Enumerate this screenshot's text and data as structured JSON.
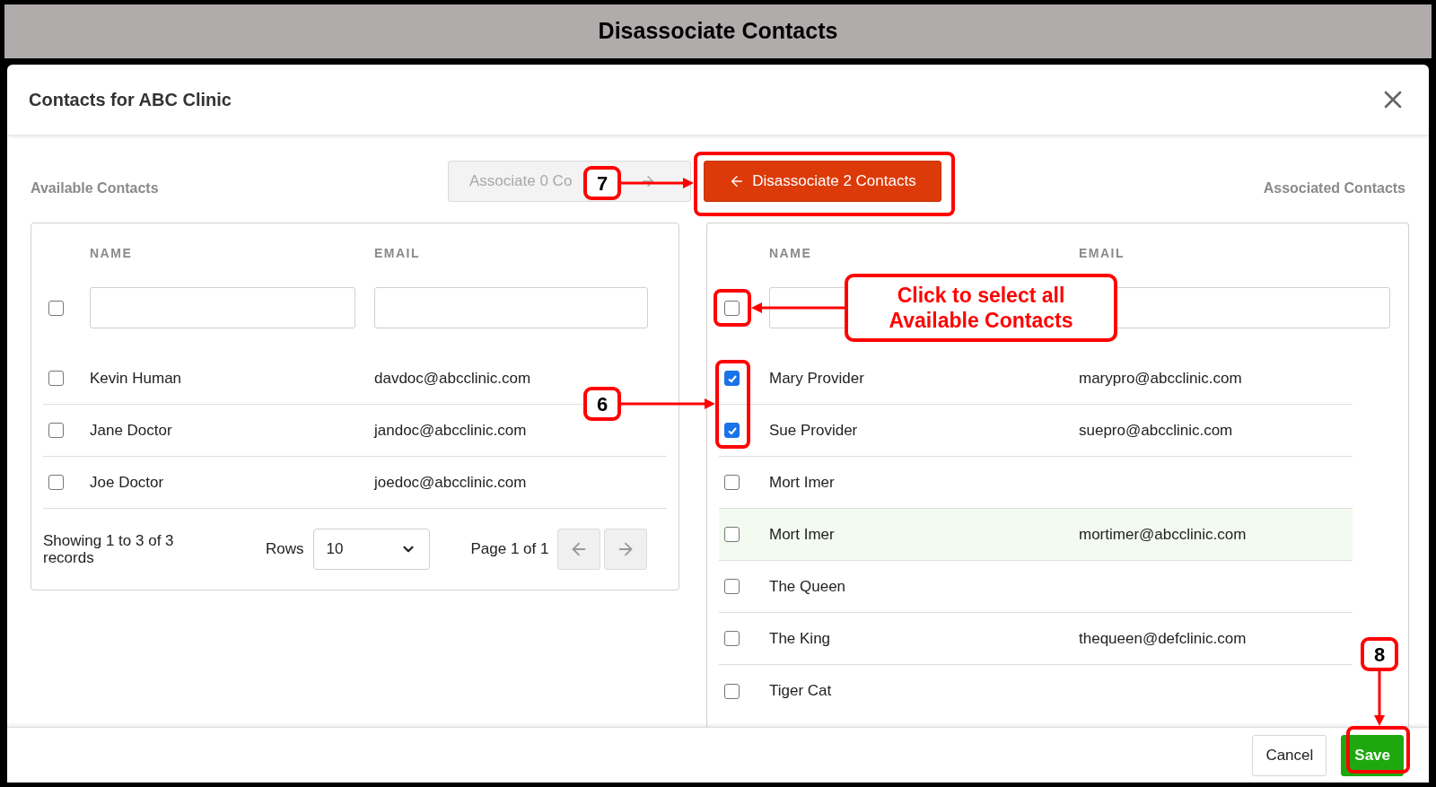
{
  "page_title": "Disassociate Contacts",
  "dialog": {
    "title": "Contacts for ABC Clinic",
    "associate_button": {
      "label": "Associate 0 Co",
      "disabled": true
    },
    "disassociate_button": {
      "label": "Disassociate 2 Contacts",
      "disabled": false
    },
    "available": {
      "heading": "Available Contacts",
      "columns": [
        "NAME",
        "EMAIL"
      ],
      "select_all": {
        "checked": false
      },
      "rows": [
        {
          "name": "Kevin Human",
          "email": "davdoc@abcclinic.com",
          "checked": false,
          "highlighted": false
        },
        {
          "name": "Jane Doctor",
          "email": "jandoc@abcclinic.com",
          "checked": false,
          "highlighted": false
        },
        {
          "name": "Joe Doctor",
          "email": "joedoc@abcclinic.com",
          "checked": false,
          "highlighted": false
        }
      ],
      "pagination": {
        "summary": "Showing 1 to 3 of 3 records",
        "rows_label": "Rows",
        "rows_value": "10",
        "page": "Page 1 of 1"
      }
    },
    "associated": {
      "heading": "Associated Contacts",
      "columns": [
        "NAME",
        "EMAIL"
      ],
      "select_all": {
        "checked": false
      },
      "rows": [
        {
          "name": "Mary Provider",
          "email": "marypro@abcclinic.com",
          "checked": true,
          "highlighted": false
        },
        {
          "name": "Sue Provider",
          "email": "suepro@abcclinic.com",
          "checked": true,
          "highlighted": false
        },
        {
          "name": "Mort Imer",
          "checked": false,
          "highlighted": false
        },
        {
          "name": "Mort Imer",
          "email": "mortimer@abcclinic.com",
          "checked": false,
          "highlighted": true
        },
        {
          "name": "The Queen",
          "checked": false,
          "highlighted": false
        },
        {
          "name": "The King",
          "email": "thequeen@defclinic.com",
          "checked": false,
          "highlighted": false
        },
        {
          "name": "Tiger Cat",
          "checked": false,
          "highlighted": false
        }
      ]
    },
    "footer_buttons": [
      {
        "label": "Cancel",
        "kind": "secondary"
      },
      {
        "label": "Save",
        "kind": "primary"
      }
    ]
  },
  "annotations": {
    "disassociate_step": {
      "label": "7"
    },
    "select_all_note": {
      "label": "Click to select all Available Contacts"
    },
    "checkbox_step": {
      "label": "6"
    },
    "save_step": {
      "label": "8"
    }
  }
}
